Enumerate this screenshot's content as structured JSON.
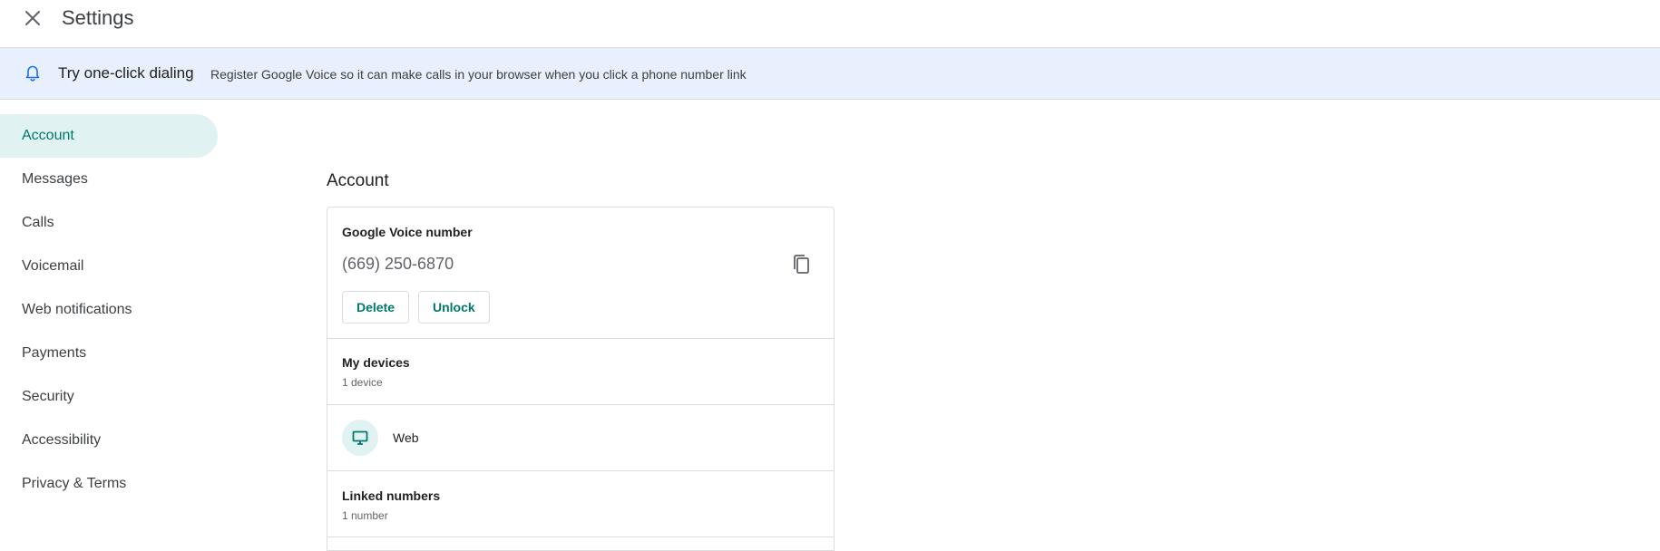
{
  "header": {
    "title": "Settings",
    "close_icon": "close-icon"
  },
  "banner": {
    "icon": "bell-icon",
    "title": "Try one-click dialing",
    "text": "Register Google Voice so it can make calls in your browser when you click a phone number link"
  },
  "sidebar": {
    "items": [
      {
        "label": "Account",
        "active": true
      },
      {
        "label": "Messages"
      },
      {
        "label": "Calls"
      },
      {
        "label": "Voicemail"
      },
      {
        "label": "Web notifications"
      },
      {
        "label": "Payments"
      },
      {
        "label": "Security"
      },
      {
        "label": "Accessibility"
      },
      {
        "label": "Privacy & Terms"
      }
    ]
  },
  "main": {
    "section_title": "Account",
    "voice_number": {
      "heading": "Google Voice number",
      "number": "(669) 250-6870",
      "copy_icon": "copy-icon",
      "delete_label": "Delete",
      "unlock_label": "Unlock"
    },
    "my_devices": {
      "heading": "My devices",
      "count": "1 device"
    },
    "device": {
      "icon": "desktop-icon",
      "label": "Web"
    },
    "linked_numbers": {
      "heading": "Linked numbers",
      "count": "1 number"
    }
  },
  "colors": {
    "accent": "#00796b",
    "active_nav_bg": "#e0f2f1",
    "banner_bg": "#e8f0fe",
    "bell_color": "#1a73e8"
  }
}
